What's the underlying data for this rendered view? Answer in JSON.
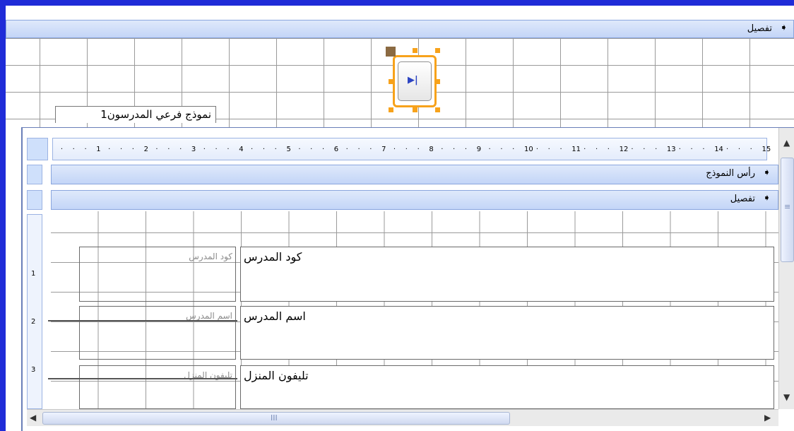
{
  "outer_detail_bar": {
    "label": "تفصيل",
    "arrow_icon": "section-arrow-icon"
  },
  "nav_button": {
    "icon": "next-record-icon",
    "glyph": "▶|"
  },
  "subform_label": "نموذج فرعي المدرسون1",
  "ruler": {
    "ticks": [
      "1",
      "2",
      "3",
      "4",
      "5",
      "6",
      "7",
      "8",
      "9",
      "10",
      "11",
      "12",
      "13",
      "14",
      "15"
    ]
  },
  "vertical_ruler": {
    "ticks": [
      "1",
      "2",
      "3"
    ]
  },
  "subform": {
    "header_bar": {
      "label": "رأس النموذج"
    },
    "detail_bar": {
      "label": "تفصيل"
    }
  },
  "fields": [
    {
      "label": "كود المدرس",
      "value": "كود المدرس"
    },
    {
      "label": "اسم المدرس",
      "value": "اسم المدرس"
    },
    {
      "label": "تليفون المنزل",
      "value": "تليفون المنزل"
    }
  ],
  "scrollbars": {
    "h_grip": "III",
    "v_grip": "≡"
  },
  "colors": {
    "window_border": "#1f2cd8",
    "selection_orange": "#f7a21b",
    "section_bar": "#c3d5f7"
  }
}
